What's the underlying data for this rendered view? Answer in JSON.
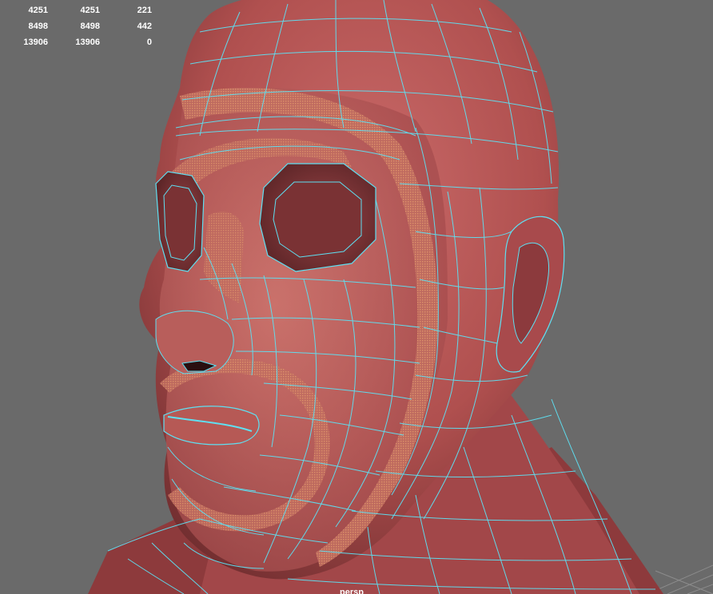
{
  "viewport": {
    "background": "#6a6a6a",
    "model_fill": "#b75457",
    "wire_color": "#5ee0f2",
    "selection_color": "#e8a060",
    "camera_label": "persp"
  },
  "hud_stats": {
    "rows": [
      {
        "c1": "4251",
        "c2": "4251",
        "c3": "221"
      },
      {
        "c1": "8498",
        "c2": "8498",
        "c3": "442"
      },
      {
        "c1": "13906",
        "c2": "13906",
        "c3": "0"
      }
    ]
  },
  "icons": {
    "grid": "grid-floor-icon"
  }
}
